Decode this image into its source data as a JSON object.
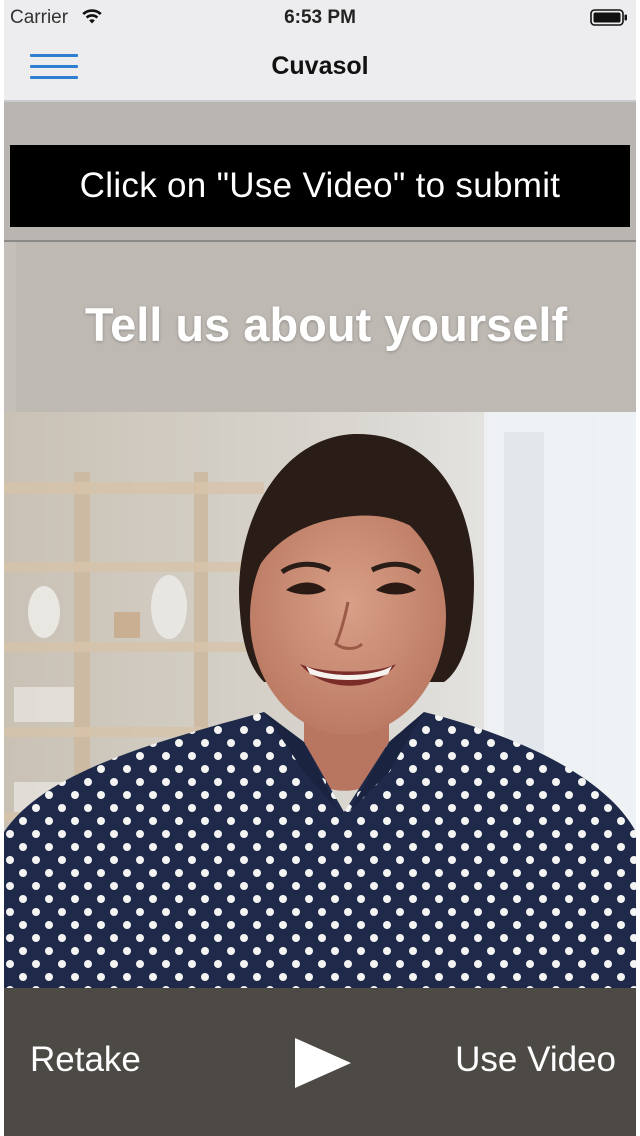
{
  "status_bar": {
    "carrier": "Carrier",
    "time": "6:53 PM"
  },
  "nav": {
    "title": "Cuvasol",
    "menu_icon": "hamburger-menu-icon"
  },
  "hint": {
    "text": "Click on \"Use Video\" to submit"
  },
  "question": {
    "text": "Tell us about yourself"
  },
  "video": {
    "description_icon": "video-preview"
  },
  "controls": {
    "retake_label": "Retake",
    "play_icon": "play-icon",
    "use_video_label": "Use Video"
  },
  "colors": {
    "accent": "#2f7fd0",
    "banner": "#000000",
    "controls_bg": "#4d4a46"
  }
}
